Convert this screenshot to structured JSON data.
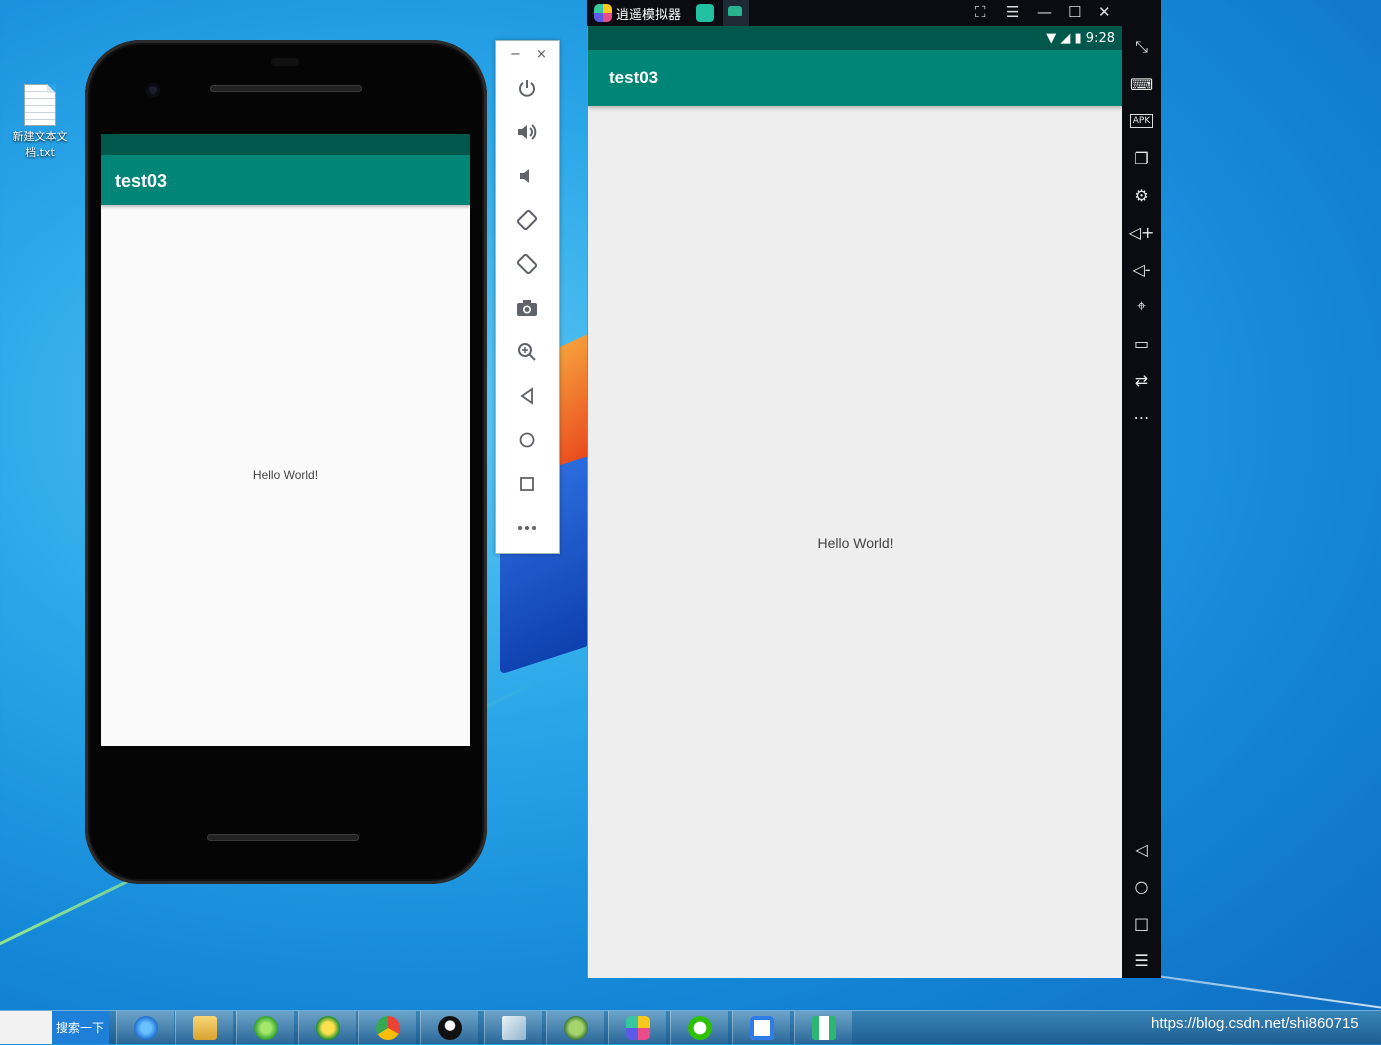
{
  "desktop": {
    "icon_label": "新建文本文档.txt"
  },
  "phone_emulator": {
    "app_title": "test03",
    "content_text": "Hello World!"
  },
  "emulator_toolbar": {
    "minimize": "−",
    "close": "×",
    "buttons": [
      "power-icon",
      "volume-up-icon",
      "volume-down-icon",
      "rotate-left-icon",
      "rotate-right-icon",
      "camera-icon",
      "zoom-icon",
      "back-icon",
      "home-icon",
      "overview-icon",
      "more-icon"
    ]
  },
  "memu_window": {
    "title": "逍遥模拟器",
    "status_time": "9:28",
    "app_title": "test03",
    "content_text": "Hello World!",
    "side_buttons": [
      "fullscreen-icon",
      "keyboard-icon",
      "apk-icon",
      "multi-window-icon",
      "settings-icon",
      "volume-up-icon",
      "volume-down-icon",
      "location-icon",
      "folder-icon",
      "sync-icon",
      "more-icon"
    ],
    "nav_buttons": [
      "back-icon",
      "home-icon",
      "recent-icon",
      "menu-icon"
    ]
  },
  "taskbar": {
    "search_button": "搜索一下",
    "apps": [
      "ie-icon",
      "explorer-icon",
      "360-browser-icon",
      "360-safe-icon",
      "chrome-icon",
      "qq-icon",
      "notepad-icon",
      "android-studio-icon",
      "memu-icon",
      "wechat-icon",
      "baidu-netdisk-icon",
      "emulator-icon"
    ],
    "url_text": "https://blog.csdn.net/shi860715"
  }
}
